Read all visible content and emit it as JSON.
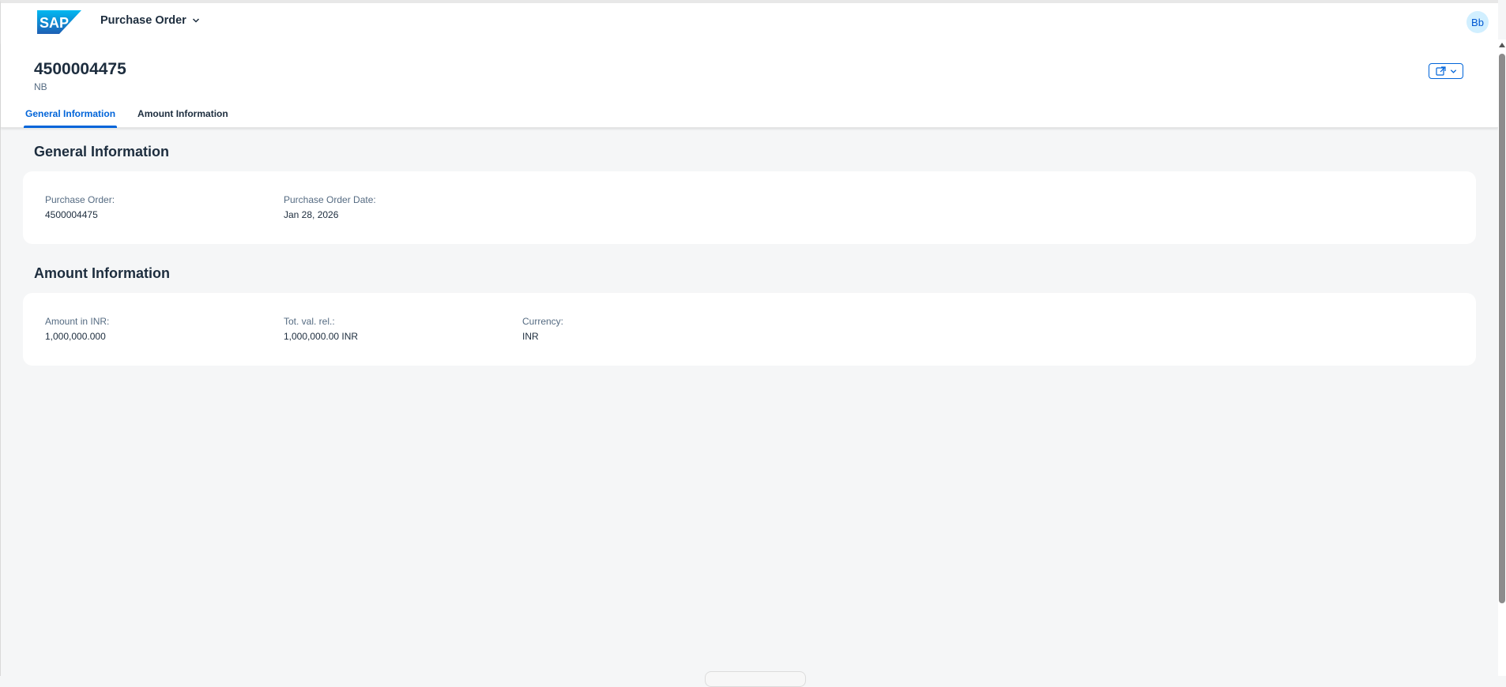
{
  "shell": {
    "logo_text": "SAP",
    "app_title": "Purchase Order",
    "user_initials": "Bb"
  },
  "header": {
    "title": "4500004475",
    "subtitle": "NB"
  },
  "tabs": [
    {
      "label": "General Information",
      "active": true
    },
    {
      "label": "Amount Information",
      "active": false
    }
  ],
  "general": {
    "title": "General Information",
    "fields": [
      {
        "label": "Purchase Order:",
        "value": "4500004475"
      },
      {
        "label": "Purchase Order Date:",
        "value": "Jan 28, 2026"
      }
    ]
  },
  "amount": {
    "title": "Amount Information",
    "fields": [
      {
        "label": "Amount in INR:",
        "value": "1,000,000.000"
      },
      {
        "label": "Tot. val. rel.:",
        "value": "1,000,000.00 INR"
      },
      {
        "label": "Currency:",
        "value": "INR"
      }
    ]
  },
  "colors": {
    "accent": "#0064d9",
    "brand_logo": "#0a6ed1",
    "background": "#f5f6f7"
  },
  "icons": {
    "app_menu": "chevron-down-icon",
    "share": "share-icon"
  }
}
